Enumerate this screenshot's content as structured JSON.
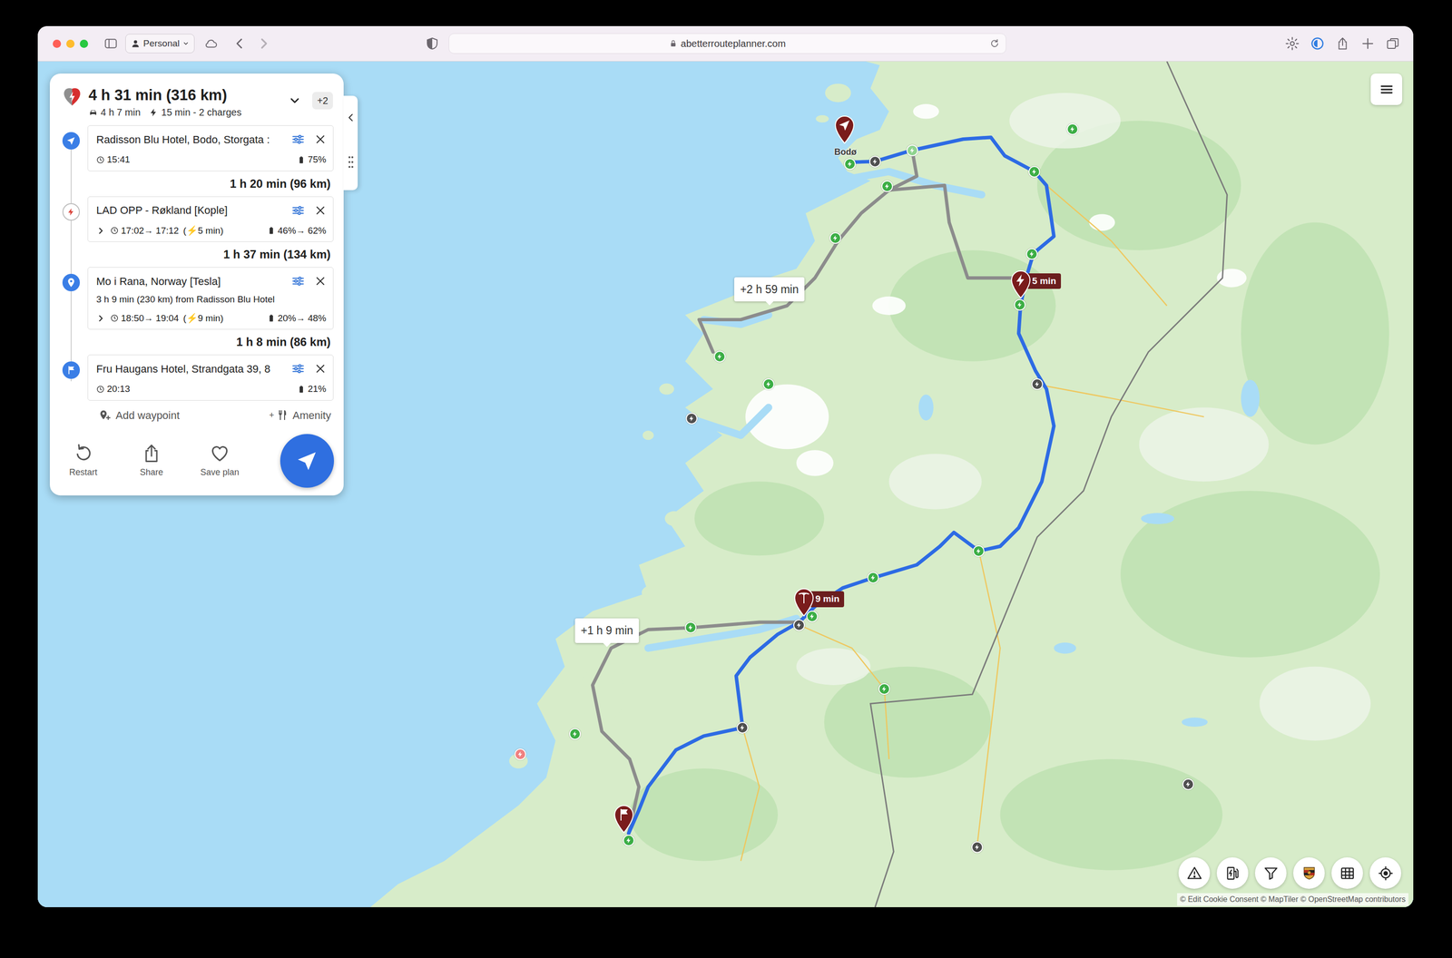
{
  "browser": {
    "profile": "Personal",
    "url": "abetterrouteplanner.com"
  },
  "plan": {
    "title": "4 h 31 min (316 km)",
    "drive": "4 h 7 min",
    "charge_summary": "15 min - 2 charges",
    "more": "+2",
    "expanded": false,
    "stops": [
      {
        "kind": "origin",
        "name": "Radisson Blu Hotel, Bodo, Storgata :",
        "time": "15:41",
        "battery": "75%"
      },
      {
        "kind": "charger",
        "name": "LAD OPP - Røkland [Kople]",
        "expanded": false,
        "time": "17:02→ 17:12",
        "charge": "(⚡5 min)",
        "battery": "46%→ 62%"
      },
      {
        "kind": "waypoint",
        "name": "Mo i Rana, Norway [Tesla]",
        "note": "3 h 9 min (230 km) from Radisson Blu Hotel",
        "expanded": false,
        "time": "18:50→ 19:04",
        "charge": "(⚡9 min)",
        "battery": "20%→ 48%"
      },
      {
        "kind": "destination",
        "name": "Fru Haugans Hotel, Strandgata 39, 8",
        "time": "20:13",
        "battery": "21%"
      }
    ],
    "legs": [
      "1 h 20 min (96 km)",
      "1 h 37 min (134 km)",
      "1 h 8 min (86 km)"
    ],
    "add_waypoint": "Add waypoint",
    "amenity_plus": "+",
    "amenity": "Amenity",
    "actions": [
      "Restart",
      "Share",
      "Save plan"
    ]
  },
  "map": {
    "city": "Bodø",
    "callouts": [
      {
        "text": "+2 h 59 min"
      },
      {
        "text": "+1 h 9 min"
      }
    ],
    "stop_pins": [
      {
        "kind": "charger",
        "text": "5 min"
      },
      {
        "kind": "tesla",
        "text": "9 min"
      }
    ],
    "chargers": [
      {
        "color": "#3cae45"
      },
      {
        "color": "#8fd48f"
      },
      {
        "color": "#3cae45"
      },
      {
        "color": "#3cae45"
      },
      {
        "color": "#3cae45"
      },
      {
        "color": "#3cae45"
      },
      {
        "color": "#3cae45"
      },
      {
        "color": "#3cae45"
      },
      {
        "color": "#3cae45"
      },
      {
        "color": "#3cae45"
      },
      {
        "color": "#3cae45"
      },
      {
        "color": "#3cae45"
      },
      {
        "color": "#3cae45"
      },
      {
        "color": "#3cae45"
      },
      {
        "color": "#3cae45"
      },
      {
        "color": "#3cae45"
      },
      {
        "color": "#3cae45"
      },
      {
        "color": "#4f4f4f"
      },
      {
        "color": "#4f4f4f"
      },
      {
        "color": "#4f4f4f"
      },
      {
        "color": "#4f4f4f"
      },
      {
        "color": "#4f4f4f"
      },
      {
        "color": "#4f4f4f"
      },
      {
        "color": "#4f4f4f"
      },
      {
        "color": "#f08080"
      }
    ],
    "attribution": "© Edit Cookie Consent © MapTiler © OpenStreetMap contributors"
  }
}
